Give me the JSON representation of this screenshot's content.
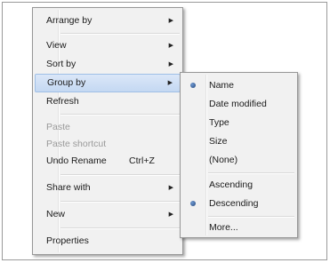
{
  "main_menu": {
    "items": [
      {
        "label": "Arrange by",
        "submenu": true
      },
      {
        "label": "View",
        "submenu": true
      },
      {
        "label": "Sort by",
        "submenu": true
      },
      {
        "label": "Group by",
        "submenu": true
      },
      {
        "label": "Refresh"
      },
      {
        "label": "Paste",
        "disabled": true
      },
      {
        "label": "Paste shortcut",
        "disabled": true
      },
      {
        "label": "Undo Rename",
        "shortcut": "Ctrl+Z"
      },
      {
        "label": "Share with",
        "submenu": true
      },
      {
        "label": "New",
        "submenu": true
      },
      {
        "label": "Properties"
      }
    ],
    "highlighted": "Group by"
  },
  "group_by_submenu": {
    "items": [
      {
        "label": "Name",
        "selected": true
      },
      {
        "label": "Date modified"
      },
      {
        "label": "Type"
      },
      {
        "label": "Size"
      },
      {
        "label": "(None)"
      },
      {
        "label": "Ascending"
      },
      {
        "label": "Descending",
        "selected": true
      },
      {
        "label": "More..."
      }
    ]
  },
  "icons": {
    "submenu_arrow": "▶",
    "radio_bullet": "bullet-icon"
  },
  "colors": {
    "menu_bg": "#f1f1f1",
    "highlight": "#c4d8f2",
    "disabled_text": "#9a9a9a"
  }
}
